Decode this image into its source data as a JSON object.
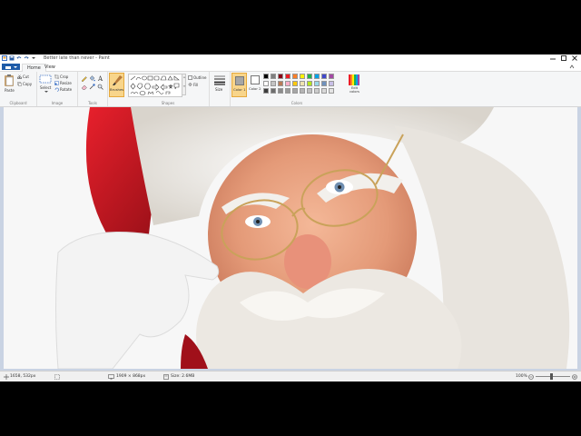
{
  "window": {
    "title": "Better late than never - Paint",
    "controls": [
      "minimize",
      "maximize",
      "close"
    ]
  },
  "tabs": {
    "file_label": "",
    "home": "Home",
    "view": "View"
  },
  "clipboard": {
    "paste": "Paste",
    "cut": "Cut",
    "copy": "Copy",
    "group": "Clipboard"
  },
  "image": {
    "select": "Select",
    "crop": "Crop",
    "resize": "Resize",
    "rotate": "Rotate",
    "group": "Image"
  },
  "tools": {
    "group": "Tools",
    "brushes": "Brushes"
  },
  "shapes": {
    "group": "Shapes",
    "outline": "Outline",
    "fill": "Fill"
  },
  "size": {
    "label": "Size"
  },
  "colors": {
    "color1": "Color 1",
    "color2": "Color 2",
    "edit": "Edit colors",
    "group": "Colors",
    "color1_value": "#a6a6a6",
    "color2_value": "#ffffff",
    "palette_row1": [
      "#000000",
      "#7f7f7f",
      "#880015",
      "#ed1c24",
      "#ff7f27",
      "#fff200",
      "#22b14c",
      "#00a2e8",
      "#3f48cc",
      "#a349a4"
    ],
    "palette_row2": [
      "#ffffff",
      "#c3c3c3",
      "#b97a57",
      "#ffaec9",
      "#ffc90e",
      "#efe4b0",
      "#b5e61d",
      "#99d9ea",
      "#7092be",
      "#c8bfe7"
    ],
    "palette_row3": [
      "#3c3c3c",
      "#6e6e6e",
      "#8c8c8c",
      "#9a9a9a",
      "#a6a6a6",
      "#b4b4b4",
      "#c0c0c0",
      "#cccccc",
      "#d8d8d8",
      "#e4e4e4"
    ]
  },
  "status": {
    "cursor": "1658, 532px",
    "dimensions": "1909 × 868px",
    "size": "Size: 2.6MB",
    "zoom": "100%"
  }
}
